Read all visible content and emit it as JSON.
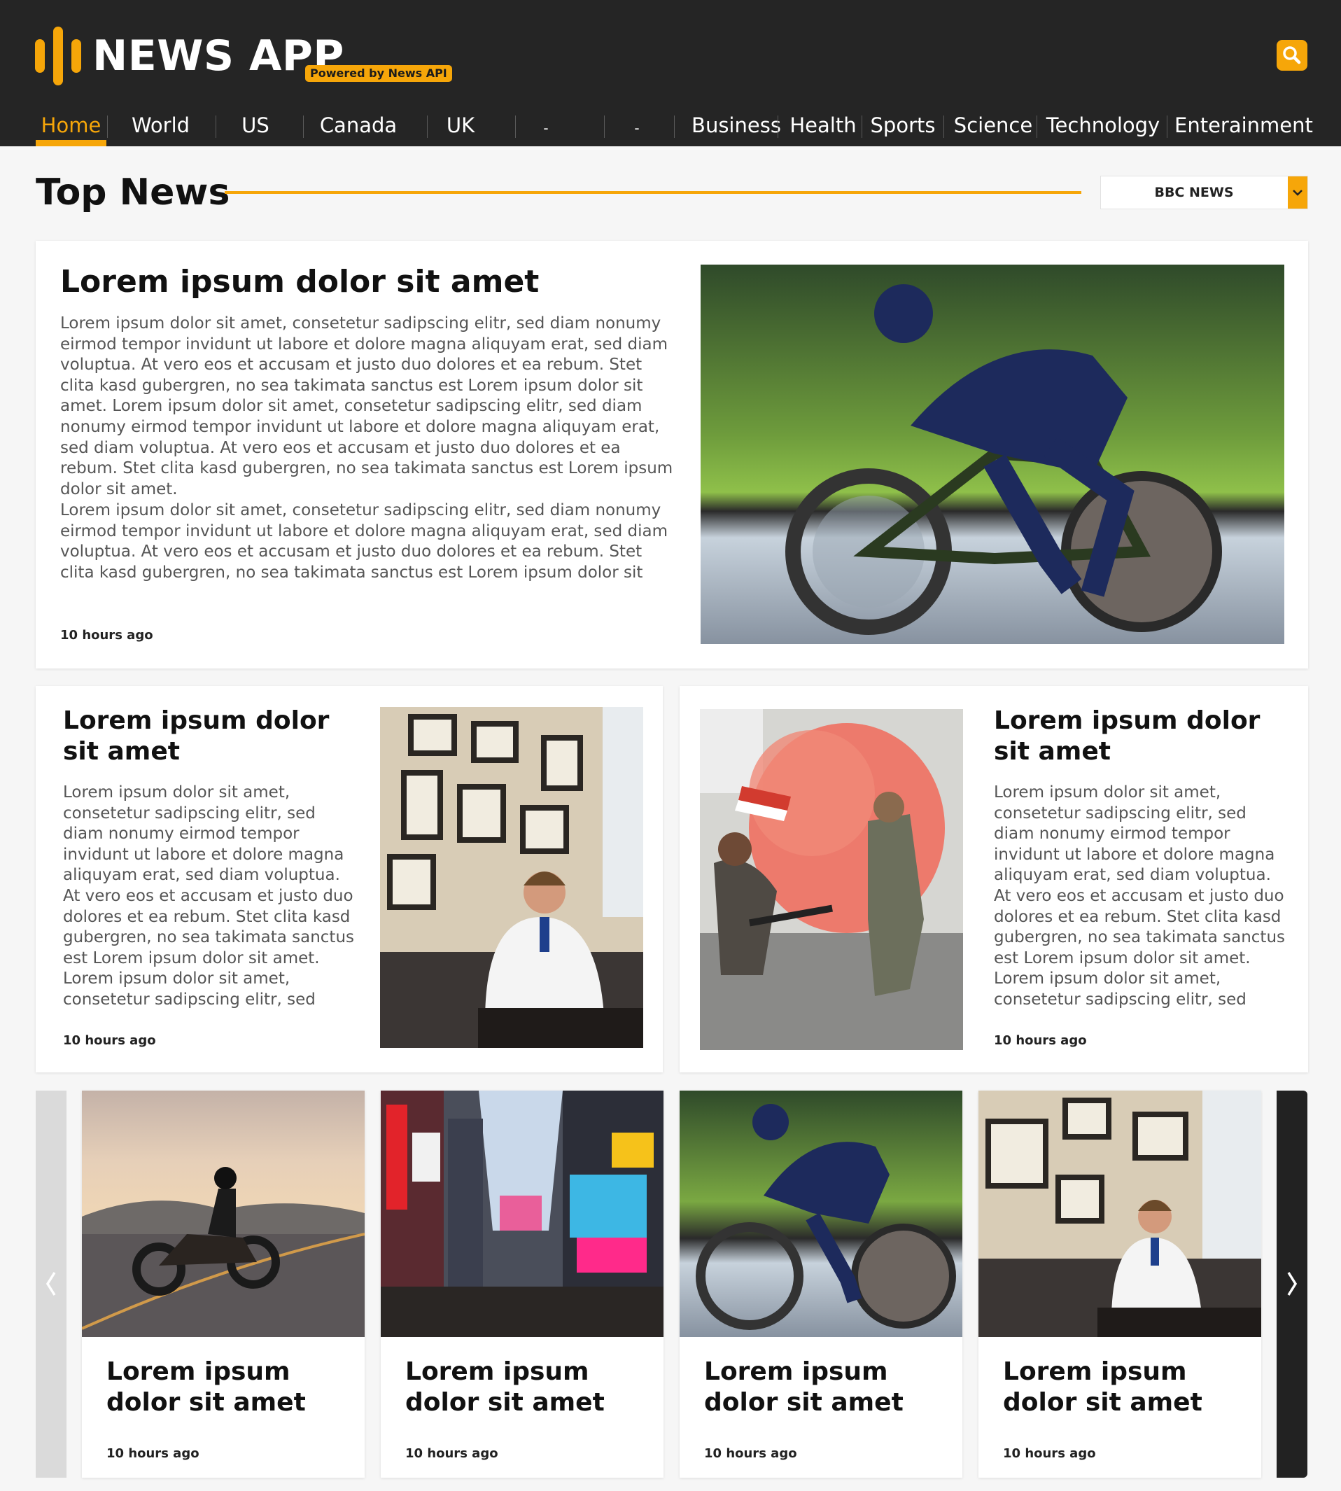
{
  "header": {
    "app_title": "NEWS APP",
    "powered_by": "Powered by News API",
    "search_icon": "search-icon",
    "brand_color": "#f6a609",
    "nav": [
      {
        "label": "Home",
        "active": true
      },
      {
        "label": "World"
      },
      {
        "label": "US"
      },
      {
        "label": "Canada"
      },
      {
        "label": "UK"
      },
      {
        "label": "-"
      },
      {
        "label": "-"
      },
      {
        "label": "Business"
      },
      {
        "label": "Health"
      },
      {
        "label": "Sports"
      },
      {
        "label": "Science"
      },
      {
        "label": "Technology"
      },
      {
        "label": "Enterainment"
      }
    ]
  },
  "top_news": {
    "title": "Top News",
    "source_select": {
      "selected": "BBC NEWS",
      "icon": "chevron-down-icon"
    }
  },
  "featured": {
    "headline": "Lorem ipsum dolor sit amet",
    "paragraph1": "Lorem ipsum dolor sit amet, consetetur sadipscing elitr, sed diam nonumy eirmod tempor invidunt ut labore et dolore magna aliquyam erat, sed diam voluptua. At vero eos et accusam et justo duo dolores et ea rebum. Stet clita kasd gubergren, no sea takimata sanctus est Lorem ipsum dolor sit amet. Lorem ipsum dolor sit amet, consetetur sadipscing elitr, sed diam nonumy eirmod tempor invidunt ut labore et dolore magna aliquyam erat, sed diam voluptua. At vero eos et accusam et justo duo dolores et ea rebum. Stet clita kasd gubergren, no sea takimata sanctus est Lorem ipsum dolor sit amet.",
    "paragraph2": "Lorem ipsum dolor sit amet, consetetur sadipscing elitr, sed diam nonumy eirmod tempor invidunt ut labore et dolore magna aliquyam erat, sed diam voluptua. At vero eos et accusam et justo duo dolores et ea rebum. Stet clita kasd gubergren, no sea takimata sanctus est Lorem ipsum dolor sit amet. Lorem ipsum dolor sit amet, consetetur sadipscing elitr, sed diam nonumy eirmod",
    "time": "10 hours ago",
    "image": "cyclist-photo"
  },
  "mid_cards": [
    {
      "headline": "Lorem ipsum dolor sit amet",
      "text": "Lorem ipsum dolor sit amet, consetetur sadipscing elitr, sed diam nonumy eirmod tempor invidunt ut labore et dolore magna aliquyam erat, sed diam voluptua. At vero eos et accusam et justo duo dolores et ea rebum. Stet clita kasd gubergren, no sea takimata sanctus est Lorem ipsum dolor sit amet. Lorem ipsum dolor sit amet, consetetur sadipscing elitr, sed diam nonumy eirmod tempor invidunt",
      "time": "10 hours ago",
      "image": "doctor-office-photo"
    },
    {
      "headline": "Lorem ipsum dolor sit amet",
      "text": "Lorem ipsum dolor sit amet, consetetur sadipscing elitr, sed diam nonumy eirmod tempor invidunt ut labore et dolore magna aliquyam erat, sed diam voluptua. At vero eos et accusam et justo duo dolores et ea rebum. Stet clita kasd gubergren, no sea takimata sanctus est Lorem ipsum dolor sit amet. Lorem ipsum dolor sit amet, consetetur sadipscing elitr, sed diam nonumy eirmod tempor invidunt",
      "time": "10 hours ago",
      "image": "reenactment-smoke-photo"
    }
  ],
  "carousel": {
    "prev_icon": "chevron-left-icon",
    "next_icon": "chevron-right-icon",
    "items": [
      {
        "headline": "Lorem ipsum dolor sit amet",
        "time": "10 hours ago",
        "image": "motorcycle-photo"
      },
      {
        "headline": "Lorem ipsum dolor sit amet",
        "time": "10 hours ago",
        "image": "times-square-photo"
      },
      {
        "headline": "Lorem ipsum dolor sit amet",
        "time": "10 hours ago",
        "image": "cyclist-photo"
      },
      {
        "headline": "Lorem ipsum dolor sit amet",
        "time": "10 hours ago",
        "image": "doctor-office-photo"
      }
    ]
  }
}
